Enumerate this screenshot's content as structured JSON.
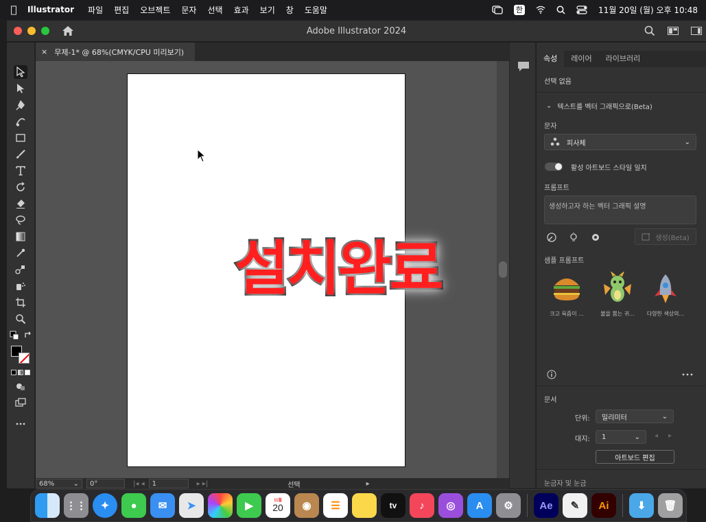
{
  "menubar": {
    "app_name": "Illustrator",
    "items": [
      "파일",
      "편집",
      "오브젝트",
      "문자",
      "선택",
      "효과",
      "보기",
      "창",
      "도움말"
    ],
    "input_source": "한",
    "clock": "11월 20일 (월) 오후 10:48"
  },
  "window": {
    "title": "Adobe Illustrator 2024"
  },
  "document": {
    "tab_label": "무제-1* @ 68%(CMYK/CPU 미리보기)",
    "canvas_text": "설치완료"
  },
  "statusbar": {
    "zoom": "68%",
    "rotation": "0°",
    "artboard_num": "1",
    "mode": "선택"
  },
  "panel": {
    "tabs": [
      "속성",
      "레이어",
      "라이브러리"
    ],
    "selection": "선택 없음",
    "section_title": "텍스트를 벡터 그래픽으로(Beta)",
    "subject_label": "문자",
    "subject_value": "피사체",
    "toggle_label": "활성 아트보드 스타일 일치",
    "prompt_label": "프롬프트",
    "prompt_placeholder": "생성하고자 하는 벡터 그래픽 설명",
    "generate_label": "생성(Beta)",
    "samples_label": "샘플 프롬프트",
    "samples": [
      "크고 육즙이 ...",
      "불을 뿜는 귀...",
      "다양한 색상의..."
    ],
    "document_label": "문서",
    "units_label": "단위:",
    "units_value": "밀리미터",
    "artboard_label": "대지:",
    "artboard_value": "1",
    "edit_artboard_label": "아트보드 편집",
    "rulers_label": "눈금자 및 눈금"
  },
  "dock": {
    "calendar_month": "11월",
    "calendar_day": "20",
    "ae_label": "Ae",
    "ai_label": "Ai",
    "tv_label": "tv"
  },
  "colors": {
    "accent_red": "#ff1f1f",
    "canvas_bg": "#535353",
    "panel_bg": "#323232"
  }
}
